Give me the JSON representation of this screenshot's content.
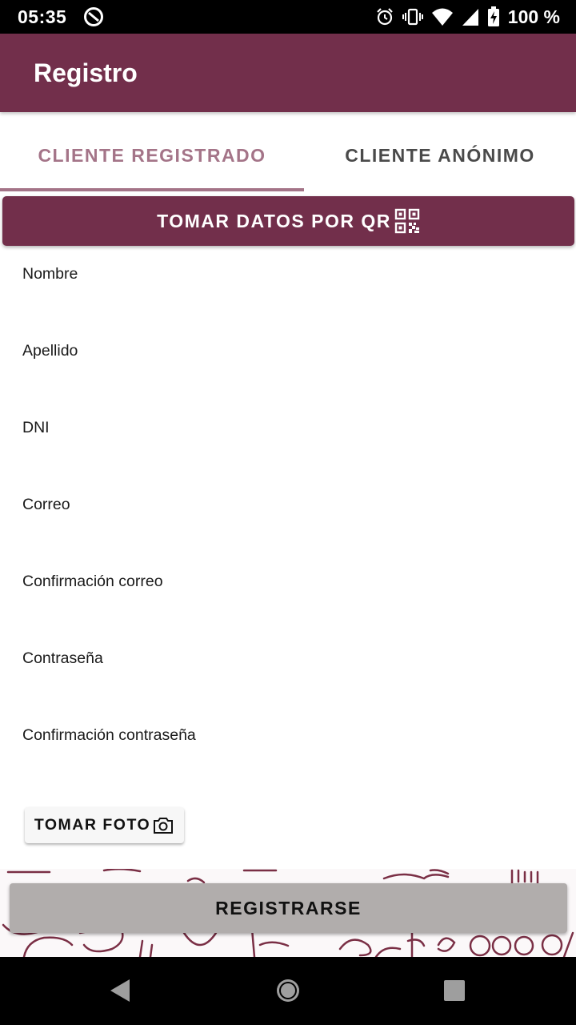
{
  "status_bar": {
    "time": "05:35",
    "battery": "100 %",
    "icons": [
      "dnd-icon",
      "alarm-icon",
      "vibrate-icon",
      "wifi-icon",
      "signal-icon",
      "battery-icon"
    ]
  },
  "app_bar": {
    "title": "Registro",
    "color": "#722f4b"
  },
  "tabs": [
    {
      "label": "CLIENTE REGISTRADO",
      "selected": true
    },
    {
      "label": "CLIENTE ANÓNIMO",
      "selected": false
    }
  ],
  "qr_button": {
    "label": "TOMAR DATOS POR QR",
    "icon": "qr-code-icon"
  },
  "form": {
    "nombre": "Nombre",
    "apellido": "Apellido",
    "dni": "DNI",
    "correo": "Correo",
    "confirmacion_correo": "Confirmación correo",
    "contrasena": "Contraseña",
    "confirmacion_contrasena": "Confirmación contraseña"
  },
  "photo_button": {
    "label": "TOMAR FOTO",
    "icon": "camera-icon"
  },
  "register_button": {
    "label": "REGISTRARSE"
  },
  "nav_bar": {
    "icons": [
      "back-icon",
      "home-icon",
      "recents-icon"
    ]
  }
}
